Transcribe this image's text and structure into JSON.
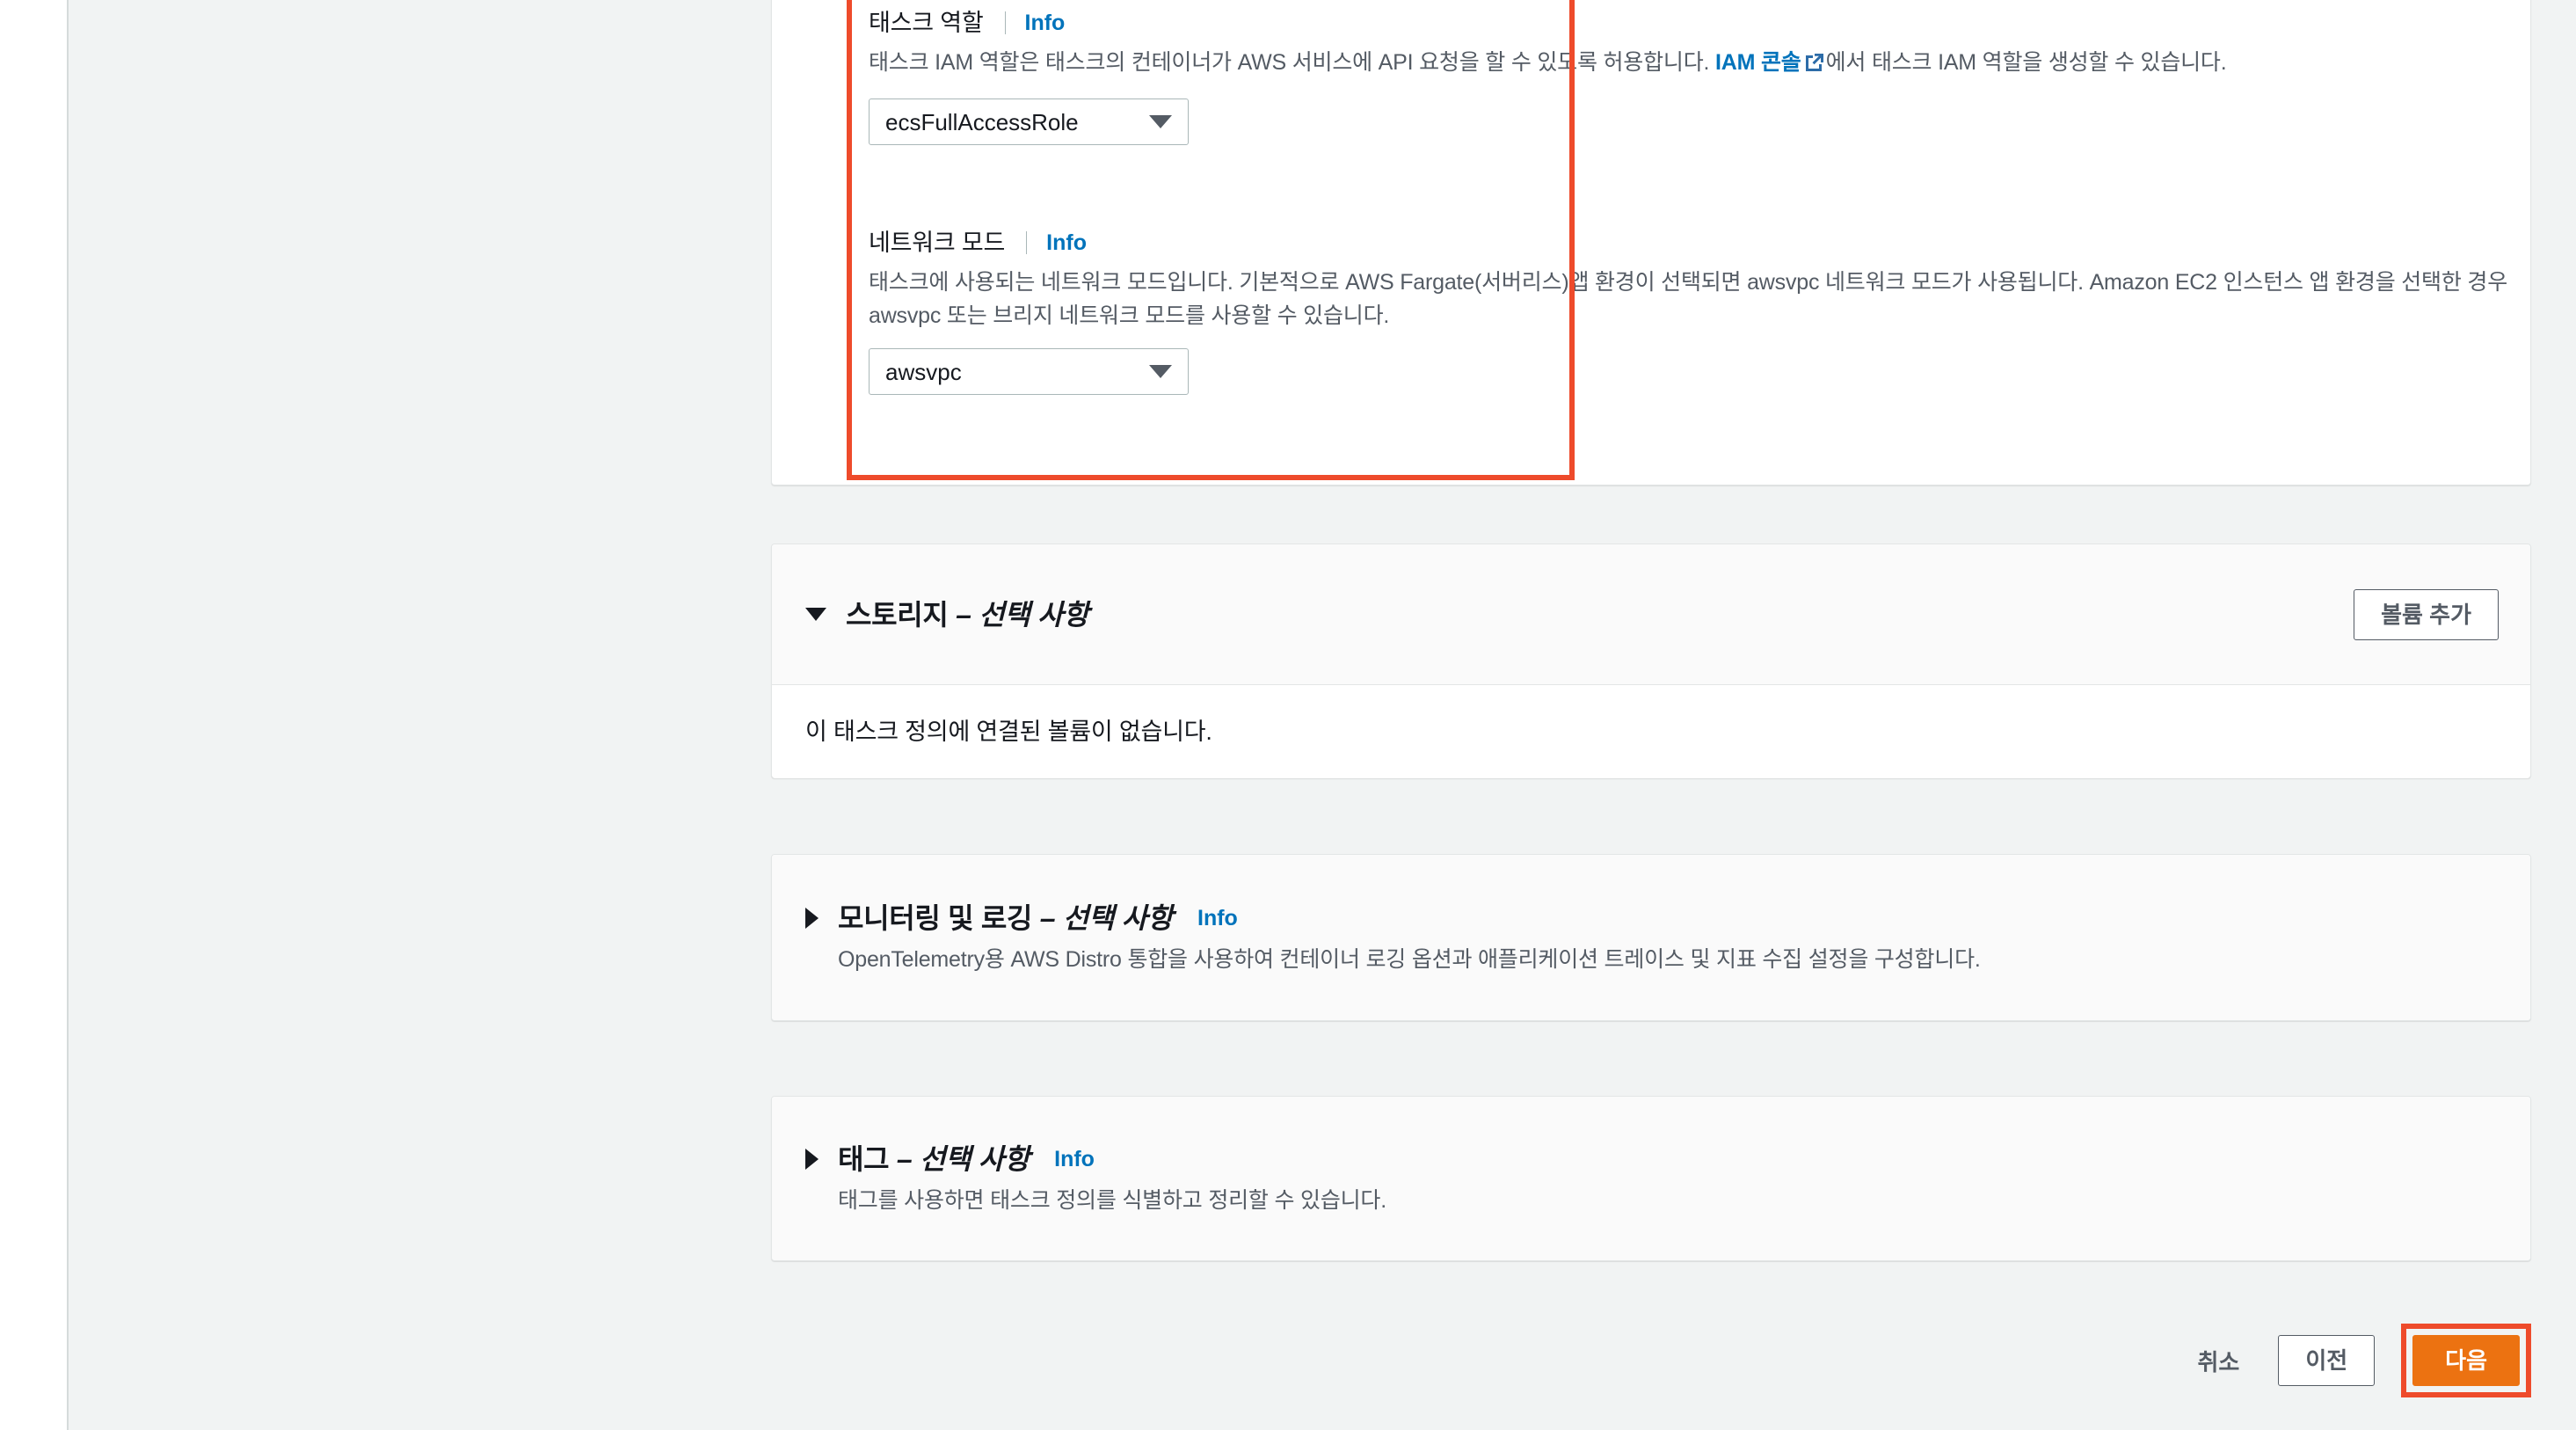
{
  "task_role": {
    "label": "태스크 역할",
    "info": "Info",
    "desc_before": "태스크 IAM 역할은 태스크의 컨테이너가 AWS 서비스에 API 요청을 할 수 있도록 허용합니다. ",
    "desc_link": "IAM 콘솔",
    "desc_after": "에서 태스크 IAM 역할을 생성할 수 있습니다.",
    "selected": "ecsFullAccessRole"
  },
  "network_mode": {
    "label": "네트워크 모드",
    "info": "Info",
    "desc": "태스크에 사용되는 네트워크 모드입니다. 기본적으로 AWS Fargate(서버리스)앱 환경이 선택되면 awsvpc 네트워크 모드가 사용됩니다. Amazon EC2 인스턴스 앱 환경을 선택한 경우 awsvpc 또는 브리지 네트워크 모드를 사용할 수 있습니다.",
    "selected": "awsvpc"
  },
  "storage": {
    "title_main": "스토리지",
    "title_optional": " – 선택 사항",
    "add_volume_button": "볼륨 추가",
    "empty_text": "이 태스크 정의에 연결된 볼륨이 없습니다."
  },
  "monitoring": {
    "title_main": "모니터링 및 로깅",
    "title_optional": " – 선택 사항",
    "info": "Info",
    "desc": "OpenTelemetry용 AWS Distro 통합을 사용하여 컨테이너 로깅 옵션과 애플리케이션 트레이스 및 지표 수집 설정을 구성합니다."
  },
  "tags": {
    "title_main": "태그",
    "title_optional": " – 선택 사항",
    "info": "Info",
    "desc": "태그를 사용하면 태스크 정의를 식별하고 정리할 수 있습니다."
  },
  "footer": {
    "cancel": "취소",
    "previous": "이전",
    "next": "다음"
  },
  "colors": {
    "highlight": "#ee4b2b",
    "primary_button": "#ec7211",
    "link": "#0073bb",
    "page_background": "#f1f3f3"
  }
}
